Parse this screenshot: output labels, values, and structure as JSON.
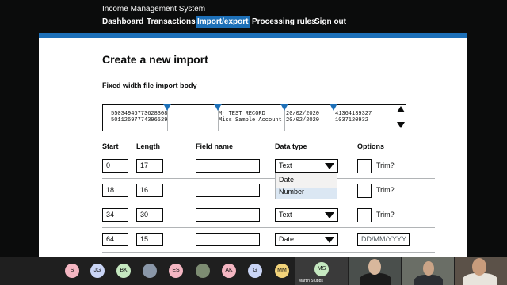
{
  "app": {
    "title": "Income Management System"
  },
  "nav": {
    "items": [
      {
        "label": "Dashboard"
      },
      {
        "label": "Transactions"
      },
      {
        "label": "Import/export"
      },
      {
        "label": "Processing rules"
      },
      {
        "label": "Sign out"
      }
    ],
    "active_index": 2
  },
  "page": {
    "title": "Create a new import",
    "fixed_width_heading": "Fixed width file import body",
    "file_lines": {
      "seg1": [
        "55034946773628308",
        "50112697774396529"
      ],
      "seg3": [
        "Mr TEST RECORD",
        "Miss Sample Account"
      ],
      "seg4": [
        "20/02/2020",
        "20/02/2020"
      ],
      "seg5": [
        "41364139327",
        "1037120932"
      ]
    }
  },
  "table": {
    "headers": {
      "start": "Start",
      "length": "Length",
      "field_name": "Field name",
      "data_type": "Data type",
      "options": "Options"
    },
    "rows": [
      {
        "start": "0",
        "length": "17",
        "field_name": "",
        "data_type": "Text",
        "option_label": "Trim?"
      },
      {
        "start": "18",
        "length": "16",
        "field_name": "",
        "data_type": "",
        "option_label": "Trim?"
      },
      {
        "start": "34",
        "length": "30",
        "field_name": "",
        "data_type": "Text",
        "option_label": "Trim?"
      },
      {
        "start": "64",
        "length": "15",
        "field_name": "",
        "data_type": "Date",
        "option_placeholder": "DD/MM/YYYY"
      }
    ],
    "dropdown_options": [
      "Date",
      "Number"
    ],
    "dropdown_highlighted": "Number"
  },
  "meeting": {
    "participants": [
      {
        "initials": "S",
        "color": "#f4b6c2"
      },
      {
        "initials": "JG",
        "color": "#c9d4f5"
      },
      {
        "initials": "BK",
        "color": "#c5e8c0"
      },
      {
        "initials": "",
        "color": "#8a97a8"
      },
      {
        "initials": "ES",
        "color": "#f4b6c2"
      },
      {
        "initials": "",
        "color": "#7d8c72"
      },
      {
        "initials": "AK",
        "color": "#f4b6c2"
      },
      {
        "initials": "G",
        "color": "#c9d4f5"
      },
      {
        "initials": "MM",
        "color": "#f2d37a"
      }
    ],
    "active_tile": {
      "initials": "MS",
      "name": "Martin Stubbs",
      "color": "#c5e8c0"
    }
  },
  "colors": {
    "brand_blue": "#1d70b8",
    "header_black": "#0b0c0c",
    "border_grey": "#b1b4b6"
  }
}
